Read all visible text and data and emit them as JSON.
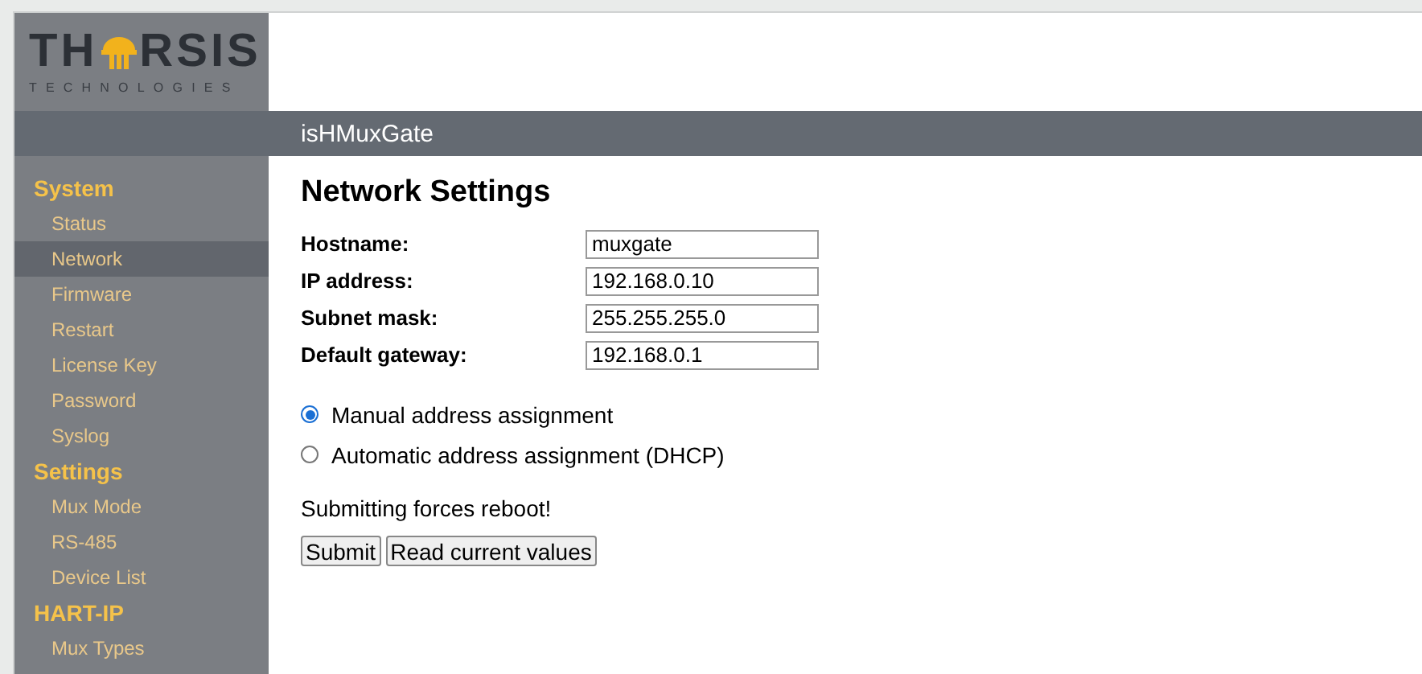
{
  "logo": {
    "word_start": "TH",
    "word_end": "RSIS",
    "tagline": "TECHNOLOGIES"
  },
  "header": {
    "title": "isHMuxGate"
  },
  "sidebar": {
    "sections": [
      {
        "title": "System",
        "items": [
          {
            "label": "Status",
            "selected": false
          },
          {
            "label": "Network",
            "selected": true
          },
          {
            "label": "Firmware",
            "selected": false
          },
          {
            "label": "Restart",
            "selected": false
          },
          {
            "label": "License Key",
            "selected": false
          },
          {
            "label": "Password",
            "selected": false
          },
          {
            "label": "Syslog",
            "selected": false
          }
        ]
      },
      {
        "title": "Settings",
        "items": [
          {
            "label": "Mux Mode",
            "selected": false
          },
          {
            "label": "RS-485",
            "selected": false
          },
          {
            "label": "Device List",
            "selected": false
          }
        ]
      },
      {
        "title": "HART-IP",
        "items": [
          {
            "label": "Mux Types",
            "selected": false
          }
        ]
      }
    ]
  },
  "content": {
    "title": "Network Settings",
    "fields": [
      {
        "label": "Hostname:",
        "value": "muxgate"
      },
      {
        "label": "IP address:",
        "value": "192.168.0.10"
      },
      {
        "label": "Subnet mask:",
        "value": "255.255.255.0"
      },
      {
        "label": "Default gateway:",
        "value": "192.168.0.1"
      }
    ],
    "options": [
      {
        "label": "Manual address assignment",
        "selected": true
      },
      {
        "label": "Automatic address assignment (DHCP)",
        "selected": false
      }
    ],
    "note": "Submitting forces reboot!",
    "buttons": [
      "Submit",
      "Read current values"
    ]
  }
}
